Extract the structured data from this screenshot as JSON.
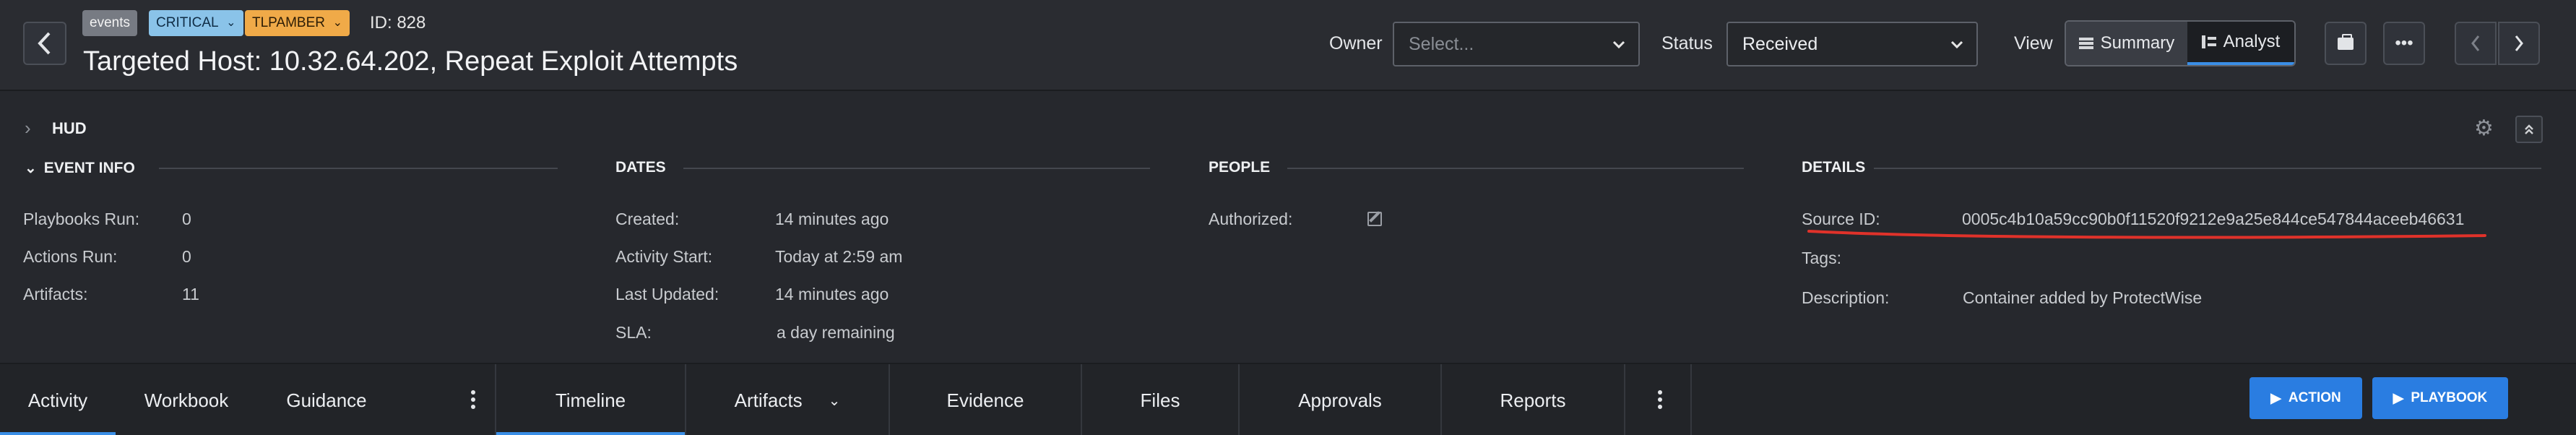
{
  "header": {
    "back_glyph": "‹",
    "badges": {
      "events": "events",
      "critical": "CRITICAL",
      "tlp": "TLPAMBER"
    },
    "event_id": "ID: 828",
    "title": "Targeted Host: 10.32.64.202, Repeat Exploit Attempts",
    "owner_label": "Owner",
    "owner_placeholder": "Select...",
    "status_label": "Status",
    "status_value": "Received",
    "view_label": "View",
    "view_summary": "Summary",
    "view_analyst": "Analyst",
    "icons": {
      "briefcase": "briefcase-icon",
      "more": "ellipsis-icon",
      "prev": "chevron-left-icon",
      "next": "chevron-right-icon"
    }
  },
  "hud": {
    "label": "HUD"
  },
  "event_info": {
    "title": "EVENT INFO",
    "rows": [
      {
        "label": "Playbooks Run:",
        "value": "0"
      },
      {
        "label": "Actions Run:",
        "value": "0"
      },
      {
        "label": "Artifacts:",
        "value": "11"
      }
    ]
  },
  "dates": {
    "title": "DATES",
    "rows": [
      {
        "label": "Created:",
        "value": "14 minutes ago"
      },
      {
        "label": "Activity Start:",
        "value": "Today at 2:59 am"
      },
      {
        "label": "Last Updated:",
        "value": "14 minutes ago"
      },
      {
        "label": "SLA:",
        "value": "a day remaining"
      }
    ]
  },
  "people": {
    "title": "PEOPLE",
    "rows": [
      {
        "label": "Authorized:",
        "value": ""
      }
    ]
  },
  "details": {
    "title": "DETAILS",
    "rows": [
      {
        "label": "Source ID:",
        "value": "0005c4b10a59cc90b0f11520f9212e9a25e844ce547844aceeb46631"
      },
      {
        "label": "Tags:",
        "value": ""
      },
      {
        "label": "Description:",
        "value": "Container added by ProtectWise"
      }
    ],
    "annotation_color": "#e0322a"
  },
  "left_tabs": [
    "Activity",
    "Workbook",
    "Guidance"
  ],
  "right_tabs": [
    "Timeline",
    "Artifacts",
    "Evidence",
    "Files",
    "Approvals",
    "Reports"
  ],
  "buttons": {
    "action": "ACTION",
    "playbook": "PLAYBOOK"
  },
  "colors": {
    "accent": "#3a8ee6",
    "button": "#2a7de1",
    "critical": "#8ac3e9",
    "tlpamber": "#f0aa48"
  }
}
